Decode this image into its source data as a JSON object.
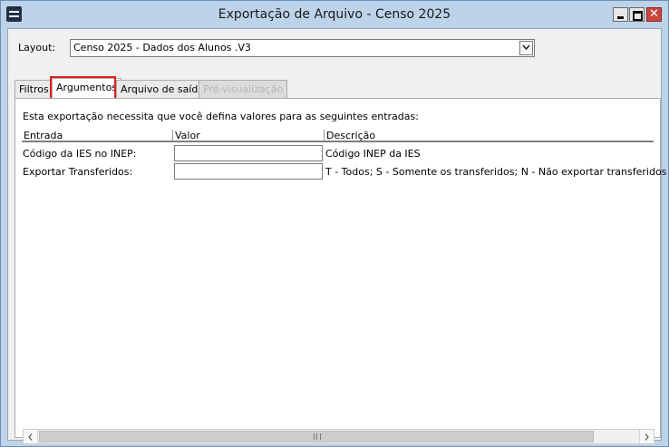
{
  "window": {
    "title": "Exportação de Arquivo - Censo 2025"
  },
  "layout": {
    "label": "Layout:",
    "value": "Censo 2025 - Dados dos Alunos .V3"
  },
  "tabs": [
    {
      "label": "Filtros",
      "state": "normal"
    },
    {
      "label": "Argumentos",
      "state": "active"
    },
    {
      "label": "Arquivo de saída",
      "state": "normal"
    },
    {
      "label": "Pré-visualização",
      "state": "disabled"
    }
  ],
  "panel": {
    "intro": "Esta exportação necessita que você defina valores para as seguintes entradas:",
    "columns": [
      "Entrada",
      "Valor",
      "Descrição"
    ],
    "rows": [
      {
        "entrada": "Código da IES no INEP:",
        "valor": "",
        "descricao": "Código INEP da IES"
      },
      {
        "entrada": "Exportar Transferidos:",
        "valor": "",
        "descricao": "T - Todos; S - Somente os transferidos; N - Não exportar transferidos"
      }
    ]
  },
  "icons": {
    "app": "menu-lines-icon",
    "minimize": "minimize-icon",
    "maximize": "maximize-icon",
    "close": "close-icon",
    "dropdown": "chevron-down-icon",
    "scroll_left": "chevron-left-icon",
    "scroll_right": "chevron-right-icon"
  },
  "colors": {
    "titlebar": "#bcd3ea",
    "close_button": "#c9463d",
    "tab_highlight": "#e02020"
  }
}
